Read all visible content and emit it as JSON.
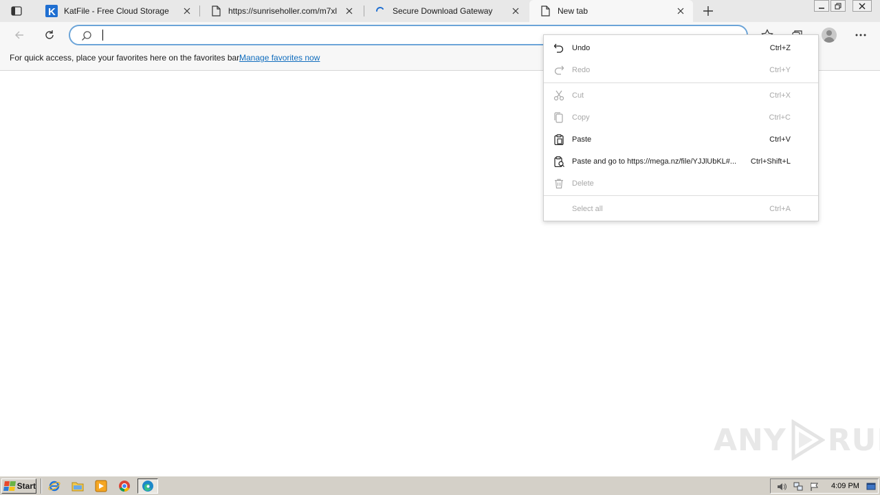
{
  "browser": {
    "tabs": [
      {
        "title": "KatFile - Free Cloud Storage",
        "icon": "katfile-k-icon",
        "active": false
      },
      {
        "title": "https://sunriseholler.com/m7xl",
        "icon": "page-icon",
        "active": false
      },
      {
        "title": "Secure Download Gateway",
        "icon": "loading-spinner-icon",
        "active": false
      },
      {
        "title": "New tab",
        "icon": "page-icon",
        "active": true
      }
    ],
    "address_bar": {
      "value": "",
      "placeholder": ""
    }
  },
  "favorites_bar": {
    "message": "For quick access, place your favorites here on the favorites bar.",
    "link_label": "Manage favorites now"
  },
  "context_menu": {
    "items": [
      {
        "label": "Undo",
        "shortcut": "Ctrl+Z",
        "enabled": true,
        "icon": "undo-icon"
      },
      {
        "label": "Redo",
        "shortcut": "Ctrl+Y",
        "enabled": false,
        "icon": "redo-icon"
      },
      {
        "label": "Cut",
        "shortcut": "Ctrl+X",
        "enabled": false,
        "icon": "scissors-icon"
      },
      {
        "label": "Copy",
        "shortcut": "Ctrl+C",
        "enabled": false,
        "icon": "copy-icon"
      },
      {
        "label": "Paste",
        "shortcut": "Ctrl+V",
        "enabled": true,
        "icon": "clipboard-icon"
      },
      {
        "label": "Paste and go to https://mega.nz/file/YJJlUbKL#...",
        "shortcut": "Ctrl+Shift+L",
        "enabled": true,
        "icon": "paste-go-icon"
      },
      {
        "label": "Delete",
        "shortcut": "",
        "enabled": false,
        "icon": "trash-icon"
      },
      {
        "label": "Select all",
        "shortcut": "Ctrl+A",
        "enabled": false,
        "icon": ""
      }
    ]
  },
  "watermark": {
    "left": "ANY",
    "right": "RUN"
  },
  "taskbar": {
    "start_label": "Start",
    "quick_launch": [
      "ie-icon",
      "folder-icon",
      "media-player-icon",
      "chrome-icon",
      "edge-icon"
    ],
    "tray_icons": [
      "speaker-icon",
      "network-icon",
      "flag-icon"
    ],
    "clock": "4:09 PM"
  },
  "colors": {
    "accent": "#0f6cbd",
    "address_border": "#6ba4d8",
    "disabled_text": "#a8a8a8",
    "taskbar": "#d4d0c8"
  }
}
